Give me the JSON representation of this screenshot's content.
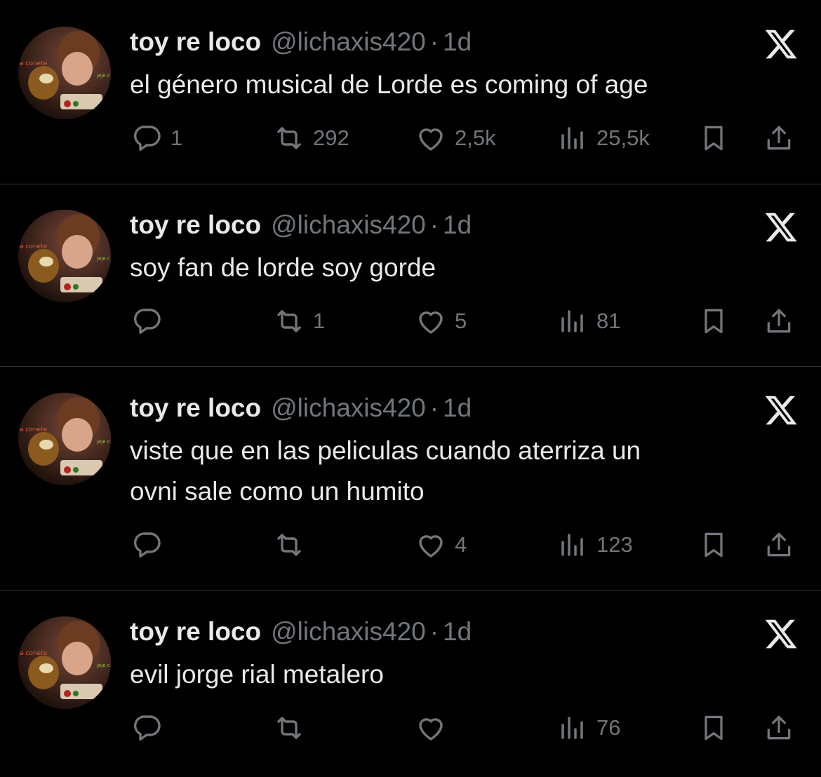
{
  "tweets": [
    {
      "name": "toy re loco",
      "handle": "@lichaxis420",
      "separator": "·",
      "time": "1d",
      "lines": [
        "el género musical de Lorde es coming of age"
      ],
      "replies": "1",
      "retweets": "292",
      "likes": "2,5k",
      "views": "25,5k"
    },
    {
      "name": "toy re loco",
      "handle": "@lichaxis420",
      "separator": "·",
      "time": "1d",
      "lines": [
        "soy fan de lorde soy gorde"
      ],
      "replies": "",
      "retweets": "1",
      "likes": "5",
      "views": "81"
    },
    {
      "name": "toy re loco",
      "handle": "@lichaxis420",
      "separator": "·",
      "time": "1d",
      "lines": [
        "viste que en las peliculas cuando aterriza un",
        "ovni sale como un humito"
      ],
      "replies": "",
      "retweets": "",
      "likes": "4",
      "views": "123"
    },
    {
      "name": "toy re loco",
      "handle": "@lichaxis420",
      "separator": "·",
      "time": "1d",
      "lines": [
        "evil jorge rial metalero"
      ],
      "replies": "",
      "retweets": "",
      "likes": "",
      "views": "76"
    }
  ],
  "avatar": {
    "caption_left": "a conete",
    "caption_right": "jeje c"
  },
  "icons": {
    "reply": "reply-icon",
    "retweet": "retweet-icon",
    "like": "heart-icon",
    "views": "views-icon",
    "bookmark": "bookmark-icon",
    "share": "share-icon",
    "brand": "x-logo-icon"
  },
  "colors": {
    "background": "#000000",
    "primary_text": "#e7e9ea",
    "secondary_text": "#71767b",
    "divider": "#2f3336"
  }
}
